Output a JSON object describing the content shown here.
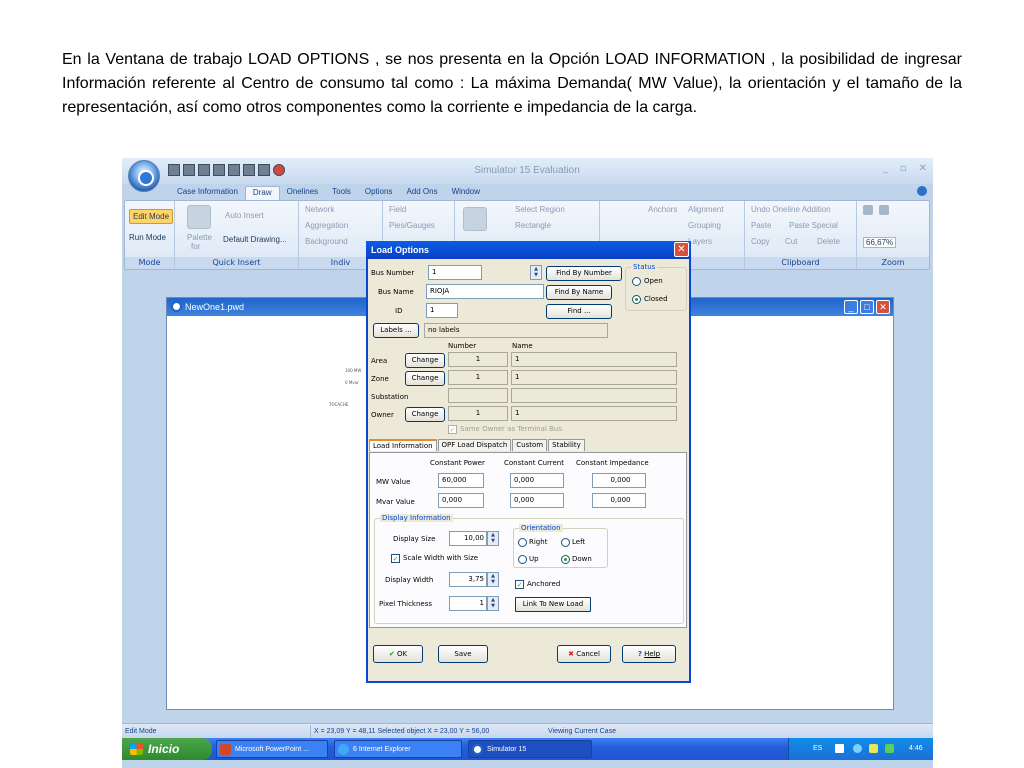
{
  "caption": "En la Ventana de trabajo LOAD OPTIONS , se nos presenta en la  Opción LOAD INFORMATION , la posibilidad de ingresar Información referente al Centro de consumo tal como : La máxima Demanda( MW Value), la orientación y el tamaño de la representación, así como otros componentes como  la corriente e impedancia de la carga.",
  "app": {
    "title": "Simulator 15 Evaluation",
    "tabs": [
      "Case Information",
      "Draw",
      "Onelines",
      "Tools",
      "Options",
      "Add Ons",
      "Window"
    ],
    "active_tab": "Draw"
  },
  "ribbon": {
    "mode": {
      "edit": "Edit Mode",
      "run": "Run Mode",
      "label": "Mode"
    },
    "quick_insert": {
      "auto_insert": "Auto Insert",
      "palette": "Palette",
      "for": "for",
      "default_drawing": "Default Drawing...",
      "label": "Quick Insert"
    },
    "individual": {
      "network": "Network",
      "aggregation": "Aggregation",
      "background": "Background",
      "label": "Indiv"
    },
    "field": {
      "field": "Field",
      "pies": "Pies/Gauges"
    },
    "select": {
      "select_region": "Select Region",
      "rectangle": "Rectangle"
    },
    "format": {
      "anchors": "Anchors",
      "alignment": "Alignment",
      "grouping": "Grouping",
      "layers": "Layers"
    },
    "clipboard": {
      "undo": "Undo Oneline Addition",
      "paste": "Paste",
      "paste_special": "Paste Special",
      "copy": "Copy",
      "cut": "Cut",
      "delete": "Delete",
      "label": "Clipboard"
    },
    "zoom": {
      "value": "66,67%",
      "label": "Zoom"
    }
  },
  "document": {
    "title": "NewOne1.pwd",
    "oneline_labels": [
      "100 MW",
      "0 Mvar",
      "TOCACHE"
    ]
  },
  "dialog": {
    "title": "Load Options",
    "bus_number_label": "Bus Number",
    "bus_number": "1",
    "bus_name_label": "Bus Name",
    "bus_name": "RIOJA",
    "id_label": "ID",
    "id": "1",
    "find_by_number": "Find By Number",
    "find_by_name": "Find By Name",
    "find": "Find ...",
    "status_title": "Status",
    "status_open": "Open",
    "status_closed": "Closed",
    "labels_btn": "Labels ...",
    "labels_value": "no labels",
    "col_number": "Number",
    "col_name": "Name",
    "area_label": "Area",
    "zone_label": "Zone",
    "substation_label": "Substation",
    "owner_label": "Owner",
    "change": "Change",
    "area_number": "1",
    "area_name": "1",
    "zone_number": "1",
    "zone_name": "1",
    "owner_number": "1",
    "owner_name": "1",
    "same_owner": "Same Owner as Terminal Bus",
    "tabs": [
      "Load Information",
      "OPF Load Dispatch",
      "Custom",
      "Stability"
    ],
    "active_tab": "Load Information",
    "constant_power": "Constant Power",
    "constant_current": "Constant Current",
    "constant_impedance": "Constant Impedance",
    "mw_label": "MW Value",
    "mvar_label": "Mvar Value",
    "mw_power": "60,000",
    "mw_current": "0,000",
    "mw_impedance": "0,000",
    "mvar_power": "0,000",
    "mvar_current": "0,000",
    "mvar_impedance": "0,000",
    "display_info_title": "Display Information",
    "display_size_label": "Display Size",
    "display_size": "10,00",
    "scale_width": "Scale Width with Size",
    "display_width_label": "Display Width",
    "display_width": "3,75",
    "pixel_thickness_label": "Pixel Thickness",
    "pixel_thickness": "1",
    "orientation_title": "Orientation",
    "right": "Right",
    "left": "Left",
    "up": "Up",
    "down": "Down",
    "anchored": "Anchored",
    "link_new_load": "Link To New Load",
    "ok": "OK",
    "save": "Save",
    "cancel": "Cancel",
    "help": "Help"
  },
  "statusbar": {
    "mode": "Edit Mode",
    "coords": "X = 23,09 Y = 48,11 Selected object X = 23,00 Y = 56,00",
    "case": "Viewing Current Case"
  },
  "taskbar": {
    "start": "Inicio",
    "items": [
      "Microsoft PowerPoint ...",
      "6 Internet Explorer",
      "Simulator 15"
    ],
    "lang": "ES",
    "time": "4:46"
  },
  "colors": {
    "accent": "#0a46d2",
    "ribbon": "#bfd3ea",
    "dialog_bg": "#ece9d8",
    "taskbar": "#245edb",
    "start": "#2d8a2d"
  }
}
